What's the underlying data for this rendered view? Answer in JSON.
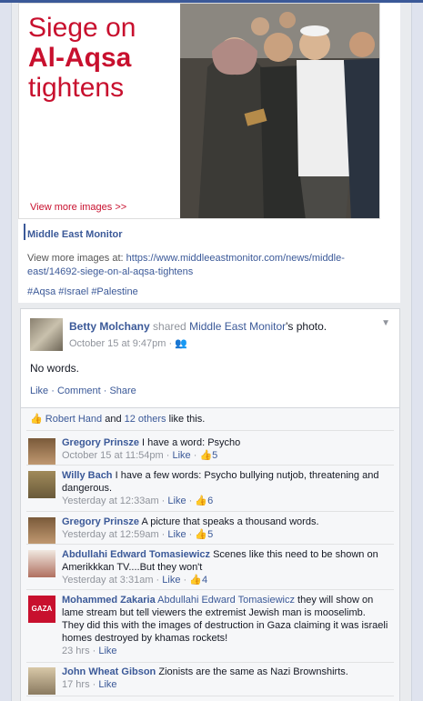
{
  "shared_card": {
    "headline_line1": "Siege on",
    "headline_line2": "Al-Aqsa",
    "headline_line3": "tightens",
    "view_more_images": "View more images >>",
    "page_name": "Middle East Monitor",
    "view_more_prefix": "View more images at:",
    "view_more_url": "https://www.middleeastmonitor.com/news/middle-east/14692-siege-on-al-aqsa-tightens",
    "hashtags": "#Aqsa #Israel #Palestine"
  },
  "post": {
    "author": "Betty Molchany",
    "shared_text": "shared",
    "page": "Middle East Monitor",
    "suffix": "'s photo.",
    "timestamp": "October 15 at 9:47pm",
    "text": "No words.",
    "actions": [
      "Like",
      "Comment",
      "Share"
    ]
  },
  "likes": {
    "first": "Robert Hand",
    "and": "and",
    "others": "12 others",
    "tail": "like this."
  },
  "comments": [
    {
      "name": "Gregory Prinsze",
      "text": "I have a word: Psycho",
      "time": "October 15 at 11:54pm",
      "like": "Like",
      "count": "5"
    },
    {
      "name": "Willy Bach",
      "text": "I have a few words: Psycho bullying nutjob, threatening and dangerous.",
      "time": "Yesterday at 12:33am",
      "like": "Like",
      "count": "6"
    },
    {
      "name": "Gregory Prinsze",
      "text": "A picture that speaks a thousand words.",
      "time": "Yesterday at 12:59am",
      "like": "Like",
      "count": "5"
    },
    {
      "name": "Abdullahi Edward Tomasiewicz",
      "text": "Scenes like this need to be shown on Amerikkkan TV....But they won't",
      "time": "Yesterday at 3:31am",
      "like": "Like",
      "count": "4"
    },
    {
      "name": "Mohammed Zakaria",
      "mention": "Abdullahi Edward Tomasiewicz",
      "text": "they will show on lame stream but tell viewers the extremist Jewish man is mooselimb. They did this with the images of destruction in Gaza claiming it was israeli homes destroyed by khamas rockets!",
      "time": "23 hrs",
      "like": "Like",
      "avatar_text": "GAZA"
    },
    {
      "name": "John Wheat Gibson",
      "text": "Zionists are the same as Nazi Brownshirts.",
      "time": "17 hrs",
      "like": "Like"
    }
  ],
  "colors": {
    "fb_blue": "#3b5998",
    "headline_red": "#c8102e"
  }
}
